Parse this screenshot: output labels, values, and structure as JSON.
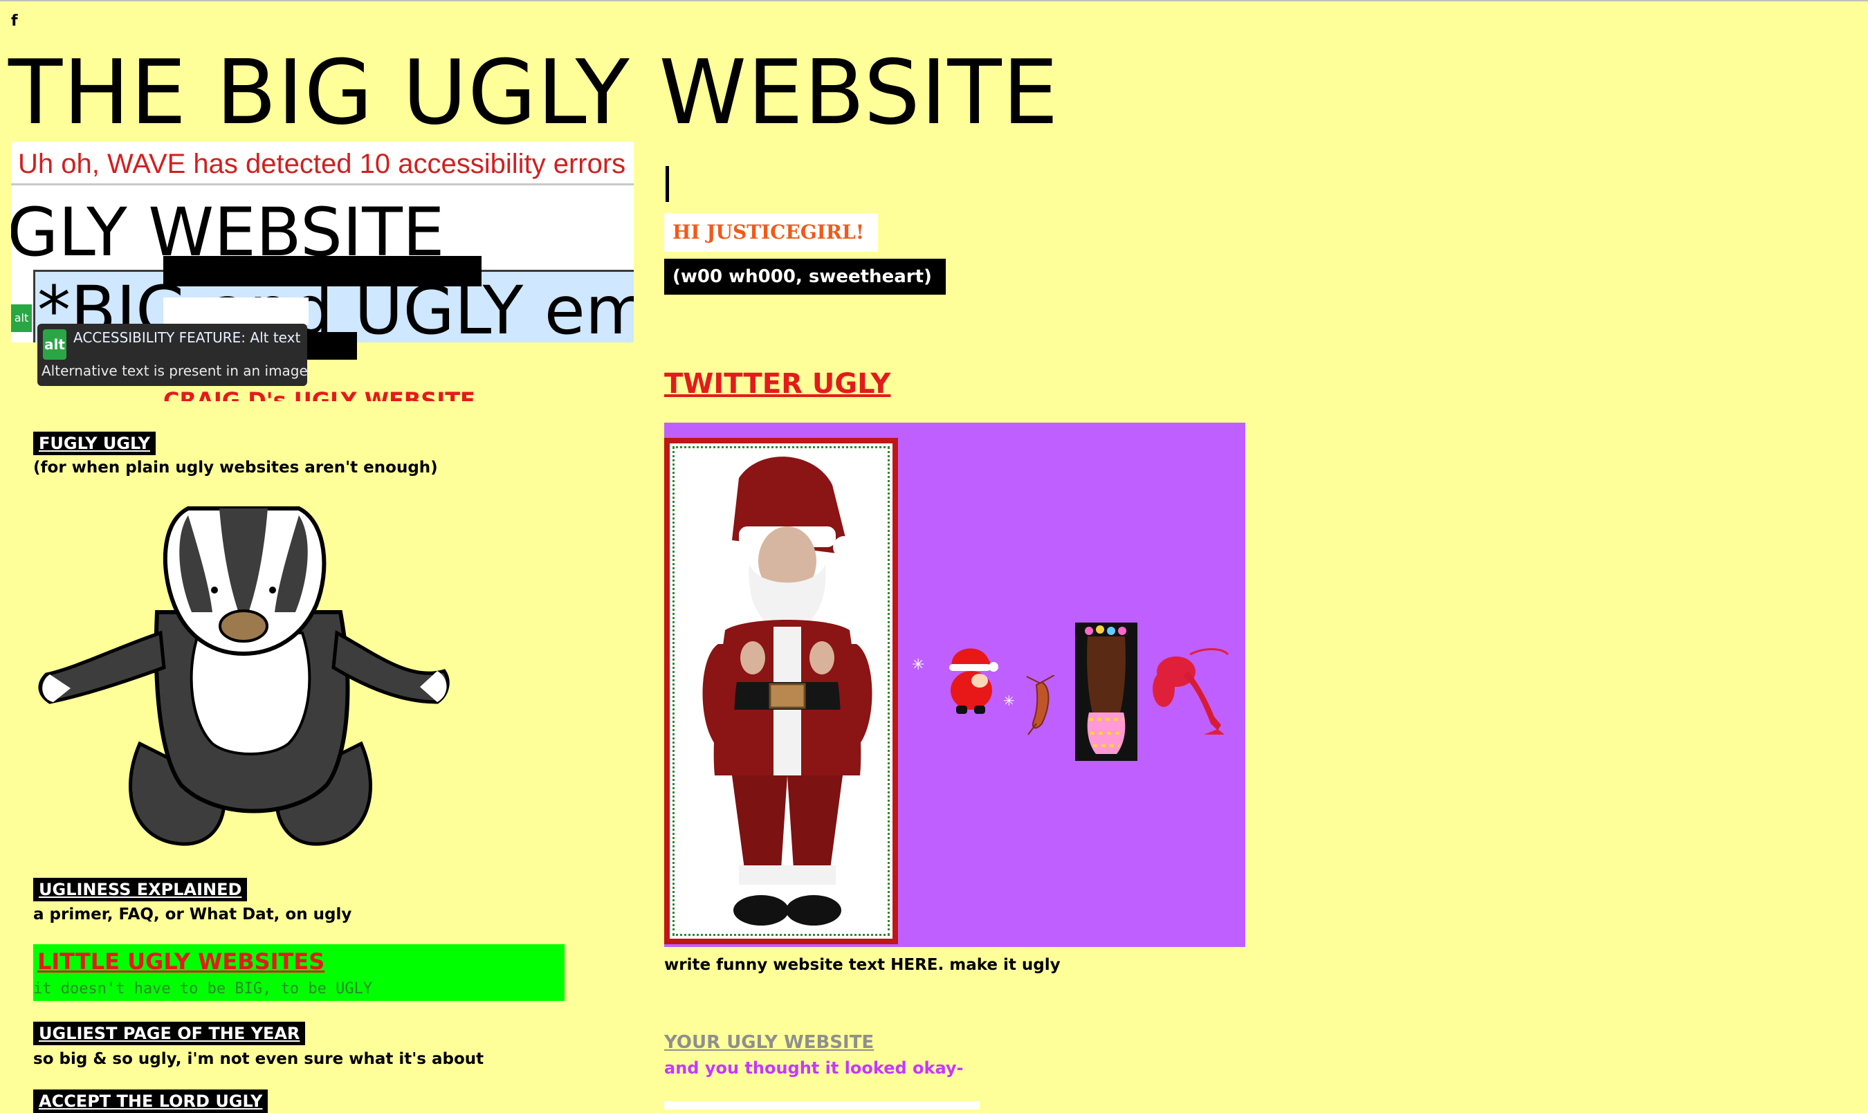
{
  "page": {
    "stray_char": "f",
    "title": "THE BIG UGLY WEBSITE"
  },
  "wave_embed": {
    "error_banner": "Uh oh, WAVE has detected 10 accessibility errors",
    "fragment_heading": "GLY WEBSITE",
    "fragment_embed": "*BIG and UGLY emb",
    "alt_badge": "alt",
    "tooltip_title": "ACCESSIBILITY FEATURE: Alt text",
    "tooltip_desc": "Alternative text is present in an image",
    "craig_link": "CRAIG D's UGLY WEBSITE"
  },
  "left_links": [
    {
      "label": "FUGLY UGLY",
      "sub": "(for when plain ugly websites aren't enough)"
    },
    {
      "label": "UGLINESS EXPLAINED",
      "sub": "a primer, FAQ, or What Dat, on ugly"
    },
    {
      "label": "LITTLE UGLY WEBSITES",
      "sub": "it doesn't have to be BIG, to be UGLY"
    },
    {
      "label": "UGLIEST PAGE OF THE YEAR",
      "sub": "so big & so ugly, i'm not even sure what it's about"
    },
    {
      "label": "ACCEPT THE LORD UGLY"
    }
  ],
  "right": {
    "greeting": "HI JUSTICEGIRL!",
    "tagline": "(w00 wh000, sweetheart)",
    "twitter_link": "TWITTER UGLY",
    "write_funny": "write funny website text HERE. make it ugly",
    "your_ugly_link": "YOUR UGLY WEBSITE",
    "your_ugly_sub": "and you thought it looked okay-"
  },
  "colors": {
    "background": "#ffff99",
    "purple_panel": "#bf5fff",
    "link_red": "#e31b1b",
    "little_green": "#00ff00",
    "greeting_orange": "#f05a1a",
    "thought_purple": "#c638ff"
  },
  "icons": [
    "badger-image",
    "santa-photo",
    "tiny-santa-gif",
    "dancing-shrimp-gif",
    "hula-dancer-gif",
    "lobster-gif",
    "sparkle-icon"
  ]
}
